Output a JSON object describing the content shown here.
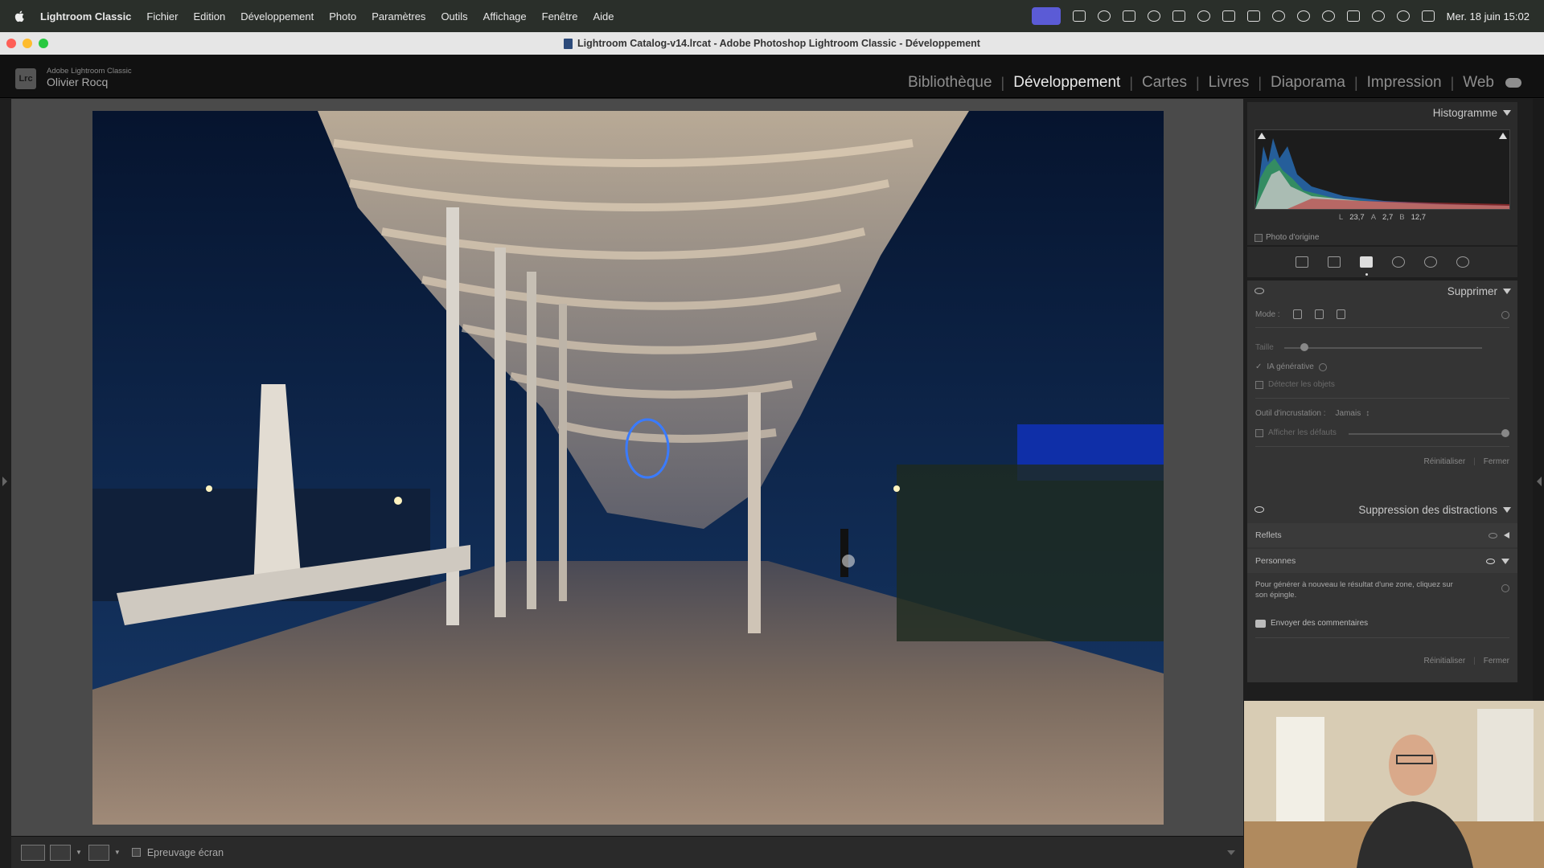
{
  "menubar": {
    "app_name": "Lightroom Classic",
    "menus": [
      "Fichier",
      "Edition",
      "Développement",
      "Photo",
      "Paramètres",
      "Outils",
      "Affichage",
      "Fenêtre",
      "Aide"
    ],
    "clock": "Mer. 18 juin  15:02"
  },
  "window": {
    "title": "Lightroom Catalog-v14.lrcat - Adobe Photoshop Lightroom Classic - Développement"
  },
  "identity": {
    "logo": "Lrc",
    "product": "Adobe Lightroom Classic",
    "user": "Olivier Rocq"
  },
  "modules": {
    "items": [
      "Bibliothèque",
      "Développement",
      "Cartes",
      "Livres",
      "Diaporama",
      "Impression",
      "Web"
    ],
    "active": "Développement"
  },
  "histogram": {
    "title": "Histogramme",
    "readout": {
      "l_label": "L",
      "l_value": "23,7",
      "a_label": "A",
      "a_value": "2,7",
      "b_label": "B",
      "b_value": "12,7"
    },
    "original_photo_label": "Photo d'origine"
  },
  "tools_strip": {
    "icons": [
      "edit-icon",
      "crop-icon",
      "remove-icon",
      "red-eye-icon",
      "mask-icon",
      "reset-icon"
    ],
    "active": "remove-icon"
  },
  "remove_panel": {
    "title": "Supprimer",
    "mode_label": "Mode :",
    "size_label": "Taille",
    "size_value": 0.1,
    "gen_ai_label": "IA générative",
    "gen_ai_checked": true,
    "detect_objects_label": "Détecter les objets",
    "detect_objects_checked": false,
    "overlay_label": "Outil d'incrustation :",
    "overlay_value": "Jamais",
    "show_defects_label": "Afficher les défauts",
    "reset_label": "Réinitialiser",
    "close_label": "Fermer"
  },
  "distractions_panel": {
    "title": "Suppression des distractions",
    "rows": [
      {
        "label": "Reflets",
        "expanded": false
      },
      {
        "label": "Personnes",
        "expanded": true
      }
    ],
    "help_text": "Pour générer à nouveau le résultat d'une zone, cliquez sur son épingle.",
    "feedback_label": "Envoyer des commentaires",
    "reset_label": "Réinitialiser",
    "close_label": "Fermer"
  },
  "toolbar": {
    "soft_proof_label": "Epreuvage écran",
    "soft_proof_checked": false
  },
  "colors": {
    "panel_bg": "#343434",
    "app_bg": "#1e1e1e",
    "active_module": "#e9e9e9",
    "menubar_active": "#5b5bd6"
  }
}
